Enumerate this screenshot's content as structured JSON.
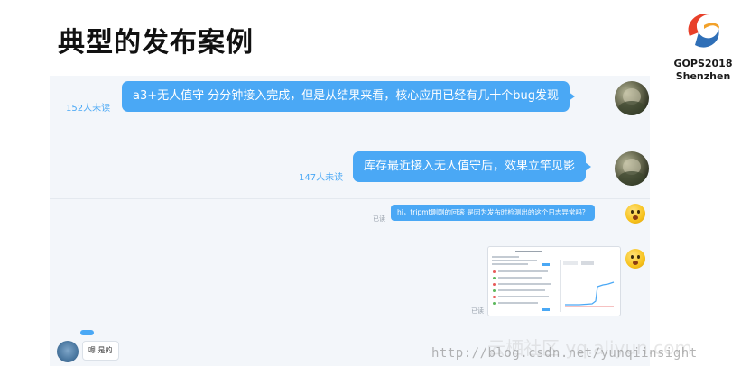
{
  "slide": {
    "title": "典型的发布案例"
  },
  "logo": {
    "line1": "GOPS2018",
    "line2": "Shenzhen"
  },
  "chat": {
    "messages_large": [
      {
        "text": "a3+无人值守 分分钟接入完成，但是从结果来看，核心应用已经有几十个bug发现",
        "unread": "152人未读"
      },
      {
        "text": "库存最近接入无人值守后，效果立竿见影",
        "unread": "147人未读"
      }
    ],
    "message_small": {
      "text": "hi，tripmt刚刚的回滚 是因为发布时检测出的这个日志异常吗？",
      "read": "已读"
    },
    "image_message": {
      "read": "已读"
    },
    "reply": {
      "text": "嗯 是的"
    }
  },
  "watermark": {
    "text": "http://blog.csdn.net/yunqiinsight",
    "faint": "云栖社区 yq.aliyun.com"
  }
}
